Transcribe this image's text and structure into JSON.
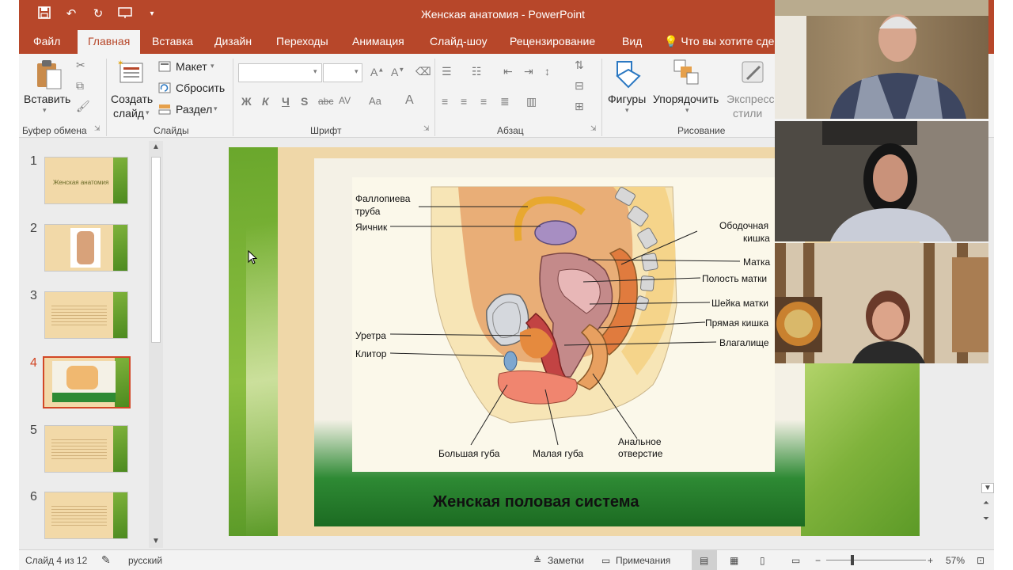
{
  "window": {
    "title": "Женская анатомия - PowerPoint"
  },
  "qat": {
    "save_icon": "save-icon",
    "undo_icon": "undo-icon",
    "redo_icon": "redo-icon",
    "present_icon": "present-icon"
  },
  "tabs": [
    {
      "label": "Файл"
    },
    {
      "label": "Главная"
    },
    {
      "label": "Вставка"
    },
    {
      "label": "Дизайн"
    },
    {
      "label": "Переходы"
    },
    {
      "label": "Анимация"
    },
    {
      "label": "Слайд-шоу"
    },
    {
      "label": "Рецензирование"
    },
    {
      "label": "Вид"
    },
    {
      "label": "Что вы хотите сде"
    }
  ],
  "ribbon": {
    "clipboard": {
      "paste": "Вставить",
      "group": "Буфер обмена"
    },
    "slides": {
      "create": "Создать",
      "create2": "слайд",
      "layout": "Макет",
      "reset": "Сбросить",
      "section": "Раздел",
      "group": "Слайды"
    },
    "font": {
      "group": "Шрифт",
      "bold": "Ж",
      "italic": "К",
      "underline": "Ч",
      "shadow": "S",
      "strike": "abc",
      "spacing": "AV",
      "case": "Aa",
      "color": "A"
    },
    "paragraph": {
      "group": "Абзац"
    },
    "drawing": {
      "shapes": "Фигуры",
      "arrange": "Упорядочить",
      "styles": "Экспресс",
      "styles2": "стили",
      "group": "Рисование"
    }
  },
  "thumbnails": [
    {
      "num": "1",
      "title": "Женская анатомия"
    },
    {
      "num": "2"
    },
    {
      "num": "3"
    },
    {
      "num": "4"
    },
    {
      "num": "5"
    },
    {
      "num": "6"
    }
  ],
  "slide": {
    "title": "Женская половая система",
    "labels": {
      "fallopian": "Фаллопиева",
      "fallopian2": "труба",
      "ovary": "Яичник",
      "colon": "Ободочная",
      "colon2": "кишка",
      "uterus": "Матка",
      "cavity": "Полость матки",
      "cervix": "Шейка матки",
      "rectum": "Прямая кишка",
      "urethra": "Уретра",
      "vagina": "Влагалище",
      "clitoris": "Клитор",
      "labia_major": "Большая губа",
      "labia_minor": "Малая губа",
      "anus": "Анальное",
      "anus2": "отверстие"
    }
  },
  "status": {
    "slide": "Слайд 4 из 12",
    "language": "русский",
    "notes": "Заметки",
    "comments": "Примечания",
    "zoom": "57%"
  }
}
